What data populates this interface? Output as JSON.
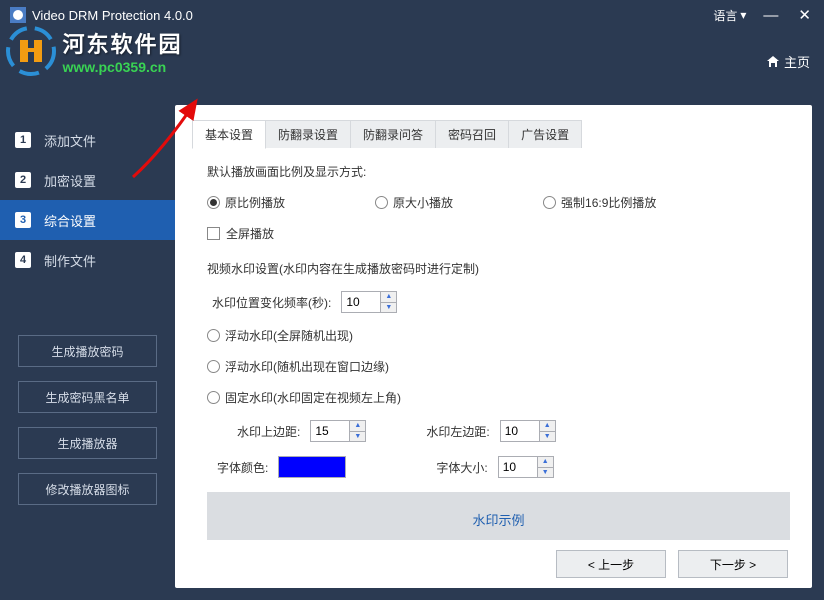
{
  "titlebar": {
    "title": "Video DRM Protection 4.0.0",
    "language_label": "语言"
  },
  "watermark": {
    "cn": "河东软件园",
    "url": "www.pc0359.cn"
  },
  "home_link": "主页",
  "sidebar": {
    "steps": [
      {
        "num": "1",
        "label": "添加文件"
      },
      {
        "num": "2",
        "label": "加密设置"
      },
      {
        "num": "3",
        "label": "综合设置"
      },
      {
        "num": "4",
        "label": "制作文件"
      }
    ],
    "buttons": {
      "gen_password": "生成播放密码",
      "gen_blacklist": "生成密码黑名单",
      "gen_player": "生成播放器",
      "modify_icon": "修改播放器图标"
    }
  },
  "tabs": {
    "basic": "基本设置",
    "anti_record": "防翻录设置",
    "anti_qa": "防翻录问答",
    "pwd_recall": "密码召回",
    "ad": "广告设置"
  },
  "content": {
    "play_ratio_label": "默认播放画面比例及显示方式:",
    "ratio_original": "原比例播放",
    "ratio_origsize": "原大小播放",
    "ratio_169": "强制16:9比例播放",
    "fullscreen": "全屏播放",
    "watermark_label": "视频水印设置(水印内容在生成播放密码时进行定制)",
    "pos_freq_label": "水印位置变化频率(秒):",
    "pos_freq_value": "10",
    "float_full": "浮动水印(全屏随机出现)",
    "float_edge": "浮动水印(随机出现在窗口边缘)",
    "fixed": "固定水印(水印固定在视频左上角)",
    "margin_top_label": "水印上边距:",
    "margin_top_value": "15",
    "margin_left_label": "水印左边距:",
    "margin_left_value": "10",
    "font_color_label": "字体颜色:",
    "font_color_value": "#0000ff",
    "font_size_label": "字体大小:",
    "font_size_value": "10",
    "example": "水印示例"
  },
  "footer": {
    "prev": "< 上一步",
    "next": "下一步 >"
  }
}
